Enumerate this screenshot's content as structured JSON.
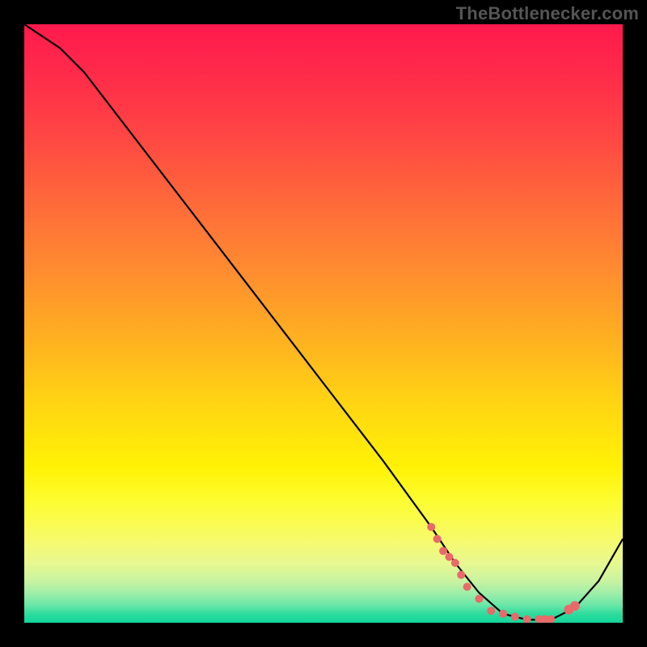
{
  "watermark": "TheBottlenecker.com",
  "chart_data": {
    "type": "line",
    "title": "",
    "xlabel": "",
    "ylabel": "",
    "xlim": [
      0,
      100
    ],
    "ylim": [
      0,
      100
    ],
    "series": [
      {
        "name": "bottleneck-curve",
        "x": [
          0,
          6,
          10,
          20,
          30,
          40,
          50,
          60,
          68,
          72,
          76,
          80,
          84,
          88,
          92,
          96,
          100
        ],
        "values": [
          100,
          96,
          92,
          79,
          66,
          53,
          40,
          27,
          16,
          10,
          5,
          1.5,
          0.5,
          0.5,
          2.5,
          7,
          14
        ]
      }
    ],
    "markers": {
      "name": "marker-points",
      "color": "#e86a6a",
      "x": [
        68,
        69,
        70,
        71,
        72,
        73,
        74,
        76,
        78,
        80,
        82,
        84,
        86,
        87,
        88,
        91,
        92
      ],
      "yrel": [
        16,
        14,
        12,
        11,
        10,
        8,
        6,
        4,
        2,
        1.5,
        1,
        0.6,
        0.6,
        0.6,
        0.6,
        2.2,
        2.8
      ],
      "r": [
        5,
        5,
        5,
        5,
        5,
        5,
        5,
        5,
        5,
        5,
        5,
        5,
        5,
        5,
        5,
        6,
        6
      ]
    },
    "gradient_stops": [
      {
        "pos": 0.0,
        "color": "#ff1a4d"
      },
      {
        "pos": 0.18,
        "color": "#ff4444"
      },
      {
        "pos": 0.42,
        "color": "#ff8f2f"
      },
      {
        "pos": 0.64,
        "color": "#ffd712"
      },
      {
        "pos": 0.8,
        "color": "#fdfd33"
      },
      {
        "pos": 0.93,
        "color": "#c9f3a0"
      },
      {
        "pos": 1.0,
        "color": "#11d69a"
      }
    ]
  }
}
